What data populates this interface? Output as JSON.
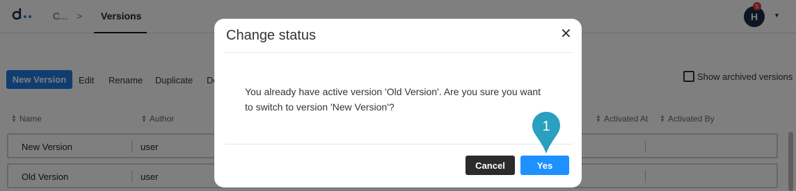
{
  "header": {
    "breadcrumb_root": "C...",
    "breadcrumb_sep": ">",
    "active_tab": "Versions",
    "avatar_initial": "H",
    "notification_count": "5"
  },
  "toolbar": {
    "new_version": "New Version",
    "edit": "Edit",
    "rename": "Rename",
    "duplicate": "Duplicate",
    "delete_partial": "De",
    "show_archived": "Show archived versions"
  },
  "table": {
    "columns": [
      "Name",
      "Author",
      "Activated At",
      "Activated By"
    ],
    "rows": [
      {
        "name": "New Version",
        "author": "user"
      },
      {
        "name": "Old Version",
        "author": "user"
      }
    ]
  },
  "modal": {
    "title": "Change status",
    "close_glyph": "✕",
    "message": "You already have active version 'Old Version'. Are you sure you want\nto switch to version 'New Version'?",
    "cancel": "Cancel",
    "yes": "Yes"
  },
  "step_marker": "1",
  "colors": {
    "primary": "#1e7be0",
    "yes_button": "#1e90ff",
    "cancel_button": "#2b2b2b",
    "step_marker": "#2a9fc0",
    "avatar": "#1c2a4a",
    "badge": "#e53935"
  }
}
